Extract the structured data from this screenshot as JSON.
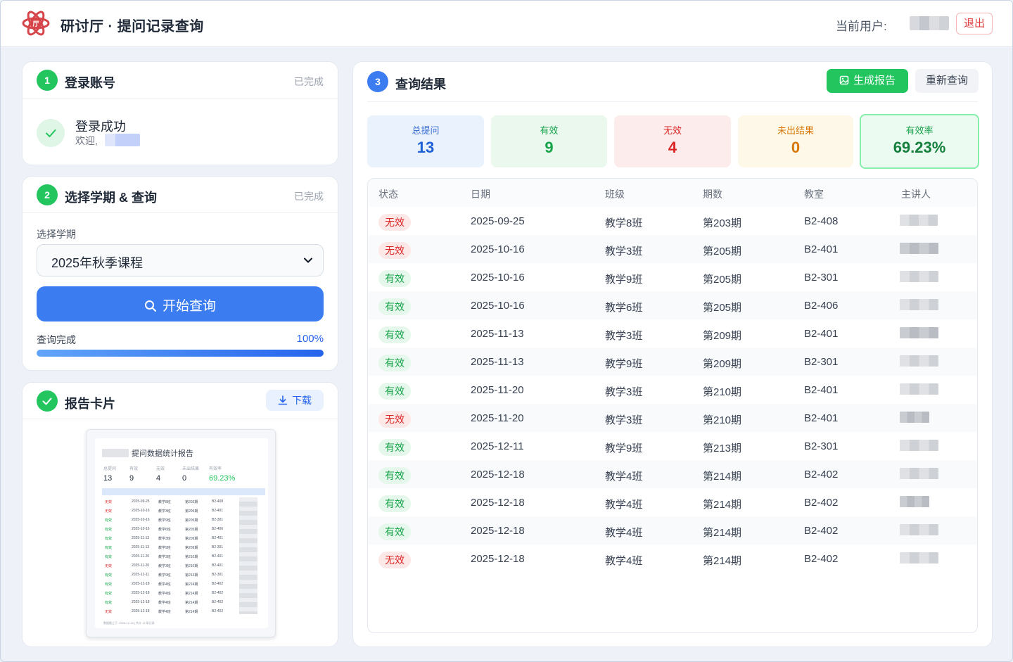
{
  "header": {
    "title": "研讨厅 · 提问记录查询",
    "user_label": "当前用户:",
    "logout": "退出"
  },
  "step1": {
    "number": "1",
    "title": "登录账号",
    "status": "已完成",
    "success_title": "登录成功",
    "welcome": "欢迎,"
  },
  "step2": {
    "number": "2",
    "title": "选择学期 & 查询",
    "status": "已完成",
    "field_label": "选择学期",
    "selected_term": "2025年秋季课程",
    "query_button": "开始查询",
    "progress_label": "查询完成",
    "progress_percent_text": "100%",
    "progress_value": 1.0
  },
  "report_card": {
    "title": "报告卡片",
    "download": "下载",
    "preview": {
      "title": "提问数据统计报告",
      "stats": [
        {
          "label": "总提问",
          "value": "13"
        },
        {
          "label": "有效",
          "value": "9"
        },
        {
          "label": "无效",
          "value": "4"
        },
        {
          "label": "未出结果",
          "value": "0"
        },
        {
          "label": "有效率",
          "value": "69.23%"
        }
      ],
      "footer": "数据截止于: 2025-12-18 | 共计 13 条记录"
    }
  },
  "step3": {
    "number": "3",
    "title": "查询结果",
    "generate_report": "生成报告",
    "requery": "重新查询",
    "stats": [
      {
        "label": "总提问",
        "value": "13"
      },
      {
        "label": "有效",
        "value": "9"
      },
      {
        "label": "无效",
        "value": "4"
      },
      {
        "label": "未出结果",
        "value": "0"
      },
      {
        "label": "有效率",
        "value": "69.23%"
      }
    ],
    "columns": [
      "状态",
      "日期",
      "班级",
      "期数",
      "教室",
      "主讲人"
    ],
    "rows": [
      {
        "status": "无效",
        "valid": false,
        "date": "2025-09-25",
        "class": "教学8班",
        "session": "第203期",
        "room": "B2-408"
      },
      {
        "status": "无效",
        "valid": false,
        "date": "2025-10-16",
        "class": "教学3班",
        "session": "第205期",
        "room": "B2-401"
      },
      {
        "status": "有效",
        "valid": true,
        "date": "2025-10-16",
        "class": "教学9班",
        "session": "第205期",
        "room": "B2-301"
      },
      {
        "status": "有效",
        "valid": true,
        "date": "2025-10-16",
        "class": "教学6班",
        "session": "第205期",
        "room": "B2-406"
      },
      {
        "status": "有效",
        "valid": true,
        "date": "2025-11-13",
        "class": "教学3班",
        "session": "第209期",
        "room": "B2-401"
      },
      {
        "status": "有效",
        "valid": true,
        "date": "2025-11-13",
        "class": "教学9班",
        "session": "第209期",
        "room": "B2-301"
      },
      {
        "status": "有效",
        "valid": true,
        "date": "2025-11-20",
        "class": "教学3班",
        "session": "第210期",
        "room": "B2-401"
      },
      {
        "status": "无效",
        "valid": false,
        "date": "2025-11-20",
        "class": "教学3班",
        "session": "第210期",
        "room": "B2-401"
      },
      {
        "status": "有效",
        "valid": true,
        "date": "2025-12-11",
        "class": "教学9班",
        "session": "第213期",
        "room": "B2-301"
      },
      {
        "status": "有效",
        "valid": true,
        "date": "2025-12-18",
        "class": "教学4班",
        "session": "第214期",
        "room": "B2-402"
      },
      {
        "status": "有效",
        "valid": true,
        "date": "2025-12-18",
        "class": "教学4班",
        "session": "第214期",
        "room": "B2-402"
      },
      {
        "status": "有效",
        "valid": true,
        "date": "2025-12-18",
        "class": "教学4班",
        "session": "第214期",
        "room": "B2-402"
      },
      {
        "status": "无效",
        "valid": false,
        "date": "2025-12-18",
        "class": "教学4班",
        "session": "第214期",
        "room": "B2-402"
      }
    ]
  },
  "colors": {
    "primary_blue": "#3b7cf0",
    "success_green": "#22c55e",
    "danger_red": "#dc2626",
    "warning_amber": "#d97706"
  },
  "icons": [
    "logo-icon",
    "check-icon",
    "search-icon",
    "chevron-down-icon",
    "download-icon",
    "image-icon"
  ]
}
